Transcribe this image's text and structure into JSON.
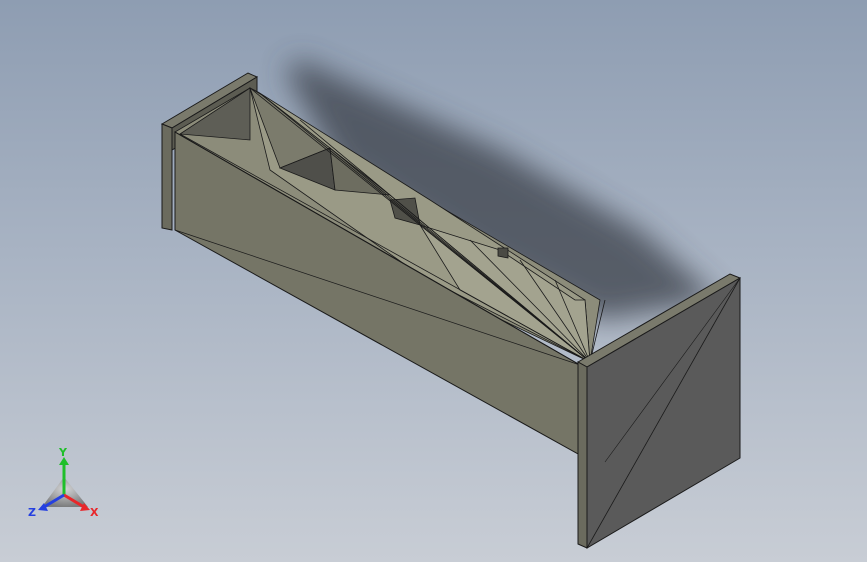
{
  "viewport": {
    "background_top": "#8e9db2",
    "background_bottom": "#c8cdd5"
  },
  "model": {
    "face_color_side": "#757566",
    "face_color_inner": "#8c8c7a",
    "face_color_plate": "#5a5a5a",
    "edge_color": "#1a1a1a"
  },
  "triad": {
    "x_label": "X",
    "y_label": "Y",
    "z_label": "Z",
    "x_color": "#e8262a",
    "y_color": "#1fbf2a",
    "z_color": "#2540e0"
  }
}
